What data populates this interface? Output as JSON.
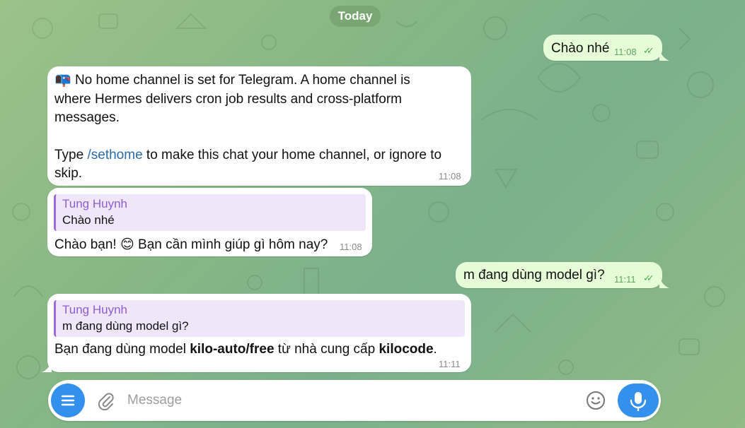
{
  "chat": {
    "date_label": "Today",
    "messages": [
      {
        "direction": "out",
        "text": "Chào nhé",
        "time": "11:08",
        "status": "read"
      },
      {
        "direction": "in",
        "emoji": "📭",
        "line1": "No home channel is set for Telegram. A home channel is",
        "line2": "where Hermes delivers cron job results and cross-platform",
        "line3": "messages.",
        "line4_pre": "Type ",
        "line4_link": "/sethome",
        "line4_post": " to make this chat your home channel, or ignore to",
        "line5": "skip.",
        "time": "11:08"
      },
      {
        "direction": "in",
        "reply_name": "Tung Huynh",
        "reply_text": "Chào nhé",
        "text_pre": "Chào bạn! ",
        "emoji": "😊",
        "text_post": " Bạn cần mình giúp gì hôm nay?",
        "time": "11:08"
      },
      {
        "direction": "out",
        "text": "m đang dùng model gì?",
        "time": "11:11",
        "status": "read"
      },
      {
        "direction": "in",
        "reply_name": "Tung Huynh",
        "reply_text": "m đang dùng model gì?",
        "text_pre": "Bạn đang dùng model ",
        "bold1": "kilo-auto/free",
        "text_mid": " từ nhà cung cấp ",
        "bold2": "kilocode",
        "text_post": ".",
        "time": "11:11"
      }
    ]
  },
  "composer": {
    "placeholder": "Message",
    "menu_icon": "menu-icon",
    "attach_icon": "paperclip-icon",
    "emoji_icon": "smiley-icon",
    "mic_icon": "microphone-icon"
  },
  "colors": {
    "accent": "#3390ec",
    "outgoing_bubble": "#e6fbd7",
    "incoming_bubble": "#ffffff",
    "reply_accent": "#9c6ad8",
    "link": "#2a6ba8"
  }
}
